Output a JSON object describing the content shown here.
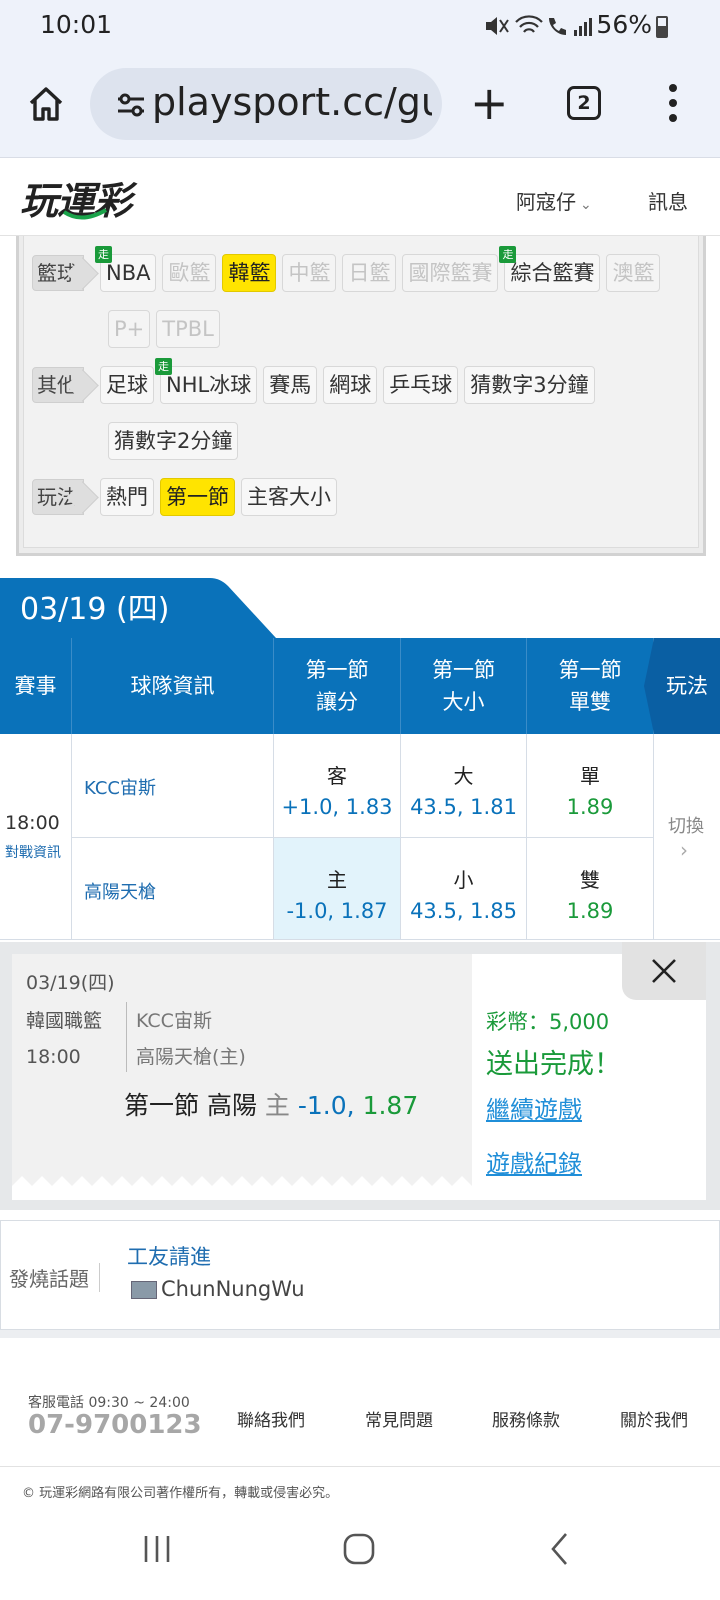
{
  "status_bar": {
    "time": "10:01",
    "battery": "56%"
  },
  "browser": {
    "url": "playsport.cc/gu",
    "tab_count": "2"
  },
  "site": {
    "logo": "玩運彩",
    "user_menu": "阿寇仔",
    "messages": "訊息"
  },
  "categories": {
    "basketball": {
      "label": "籃球",
      "chips": [
        {
          "text": "NBA",
          "state": "normal",
          "live": true
        },
        {
          "text": "歐籃",
          "state": "off"
        },
        {
          "text": "韓籃",
          "state": "selected"
        },
        {
          "text": "中籃",
          "state": "off"
        },
        {
          "text": "日籃",
          "state": "off"
        },
        {
          "text": "國際籃賽",
          "state": "off"
        },
        {
          "text": "綜合籃賽",
          "state": "normal",
          "live": true
        },
        {
          "text": "澳籃",
          "state": "off"
        },
        {
          "text": "P+",
          "state": "off"
        },
        {
          "text": "TPBL",
          "state": "off"
        }
      ]
    },
    "other": {
      "label": "其他",
      "chips": [
        {
          "text": "足球",
          "state": "normal"
        },
        {
          "text": "NHL冰球",
          "state": "normal",
          "live": true
        },
        {
          "text": "賽馬",
          "state": "normal"
        },
        {
          "text": "網球",
          "state": "normal"
        },
        {
          "text": "乒乓球",
          "state": "normal"
        },
        {
          "text": "猜數字3分鐘",
          "state": "normal"
        },
        {
          "text": "猜數字2分鐘",
          "state": "normal"
        }
      ]
    },
    "playstyle": {
      "label": "玩法",
      "chips": [
        {
          "text": "熱門",
          "state": "normal"
        },
        {
          "text": "第一節",
          "state": "selected"
        },
        {
          "text": "主客大小",
          "state": "normal"
        }
      ]
    },
    "live_badge": "走"
  },
  "schedule": {
    "date": "03/19 (四)",
    "headers": {
      "event": "賽事",
      "team_info": "球隊資訊",
      "spread_line1": "第一節",
      "spread_line2": "讓分",
      "total_line1": "第一節",
      "total_line2": "大小",
      "oddeven_line1": "第一節",
      "oddeven_line2": "單雙",
      "play": "玩法"
    },
    "game": {
      "time": "18:00",
      "matchup_link": "對戰資訊",
      "switch": "切換",
      "away": {
        "team": "KCC宙斯",
        "spread_side": "客",
        "spread_odds": "+1.0, 1.83",
        "total_side": "大",
        "total_odds": "43.5, 1.81",
        "oe_side": "單",
        "oe_odds": "1.89"
      },
      "home": {
        "team": "高陽天槍",
        "spread_side": "主",
        "spread_odds": "-1.0, 1.87",
        "total_side": "小",
        "total_odds": "43.5, 1.85",
        "oe_side": "雙",
        "oe_odds": "1.89"
      }
    }
  },
  "bet": {
    "date": "03/19(四)",
    "league": "韓國職籃",
    "time": "18:00",
    "team_away": "KCC宙斯",
    "team_home": "高陽天槍(主)",
    "pick_prefix": "第一節 高陽",
    "pick_side": "主",
    "pick_line": "-1.0,",
    "pick_odds": "1.87",
    "coins": "彩幣：5,000",
    "done": "送出完成！",
    "continue": "繼續遊戲",
    "history": "遊戲紀錄"
  },
  "hot_topic": {
    "label": "發燒話題",
    "title": "工友請進",
    "user": "ChunNungWu"
  },
  "footer": {
    "service_hours": "客服電話 09:30 ~ 24:00",
    "phone": "07-9700123",
    "links": [
      "聯絡我們",
      "常見問題",
      "服務條款",
      "關於我們"
    ],
    "copyright": "© 玩運彩網路有限公司著作權所有，轉載或侵害必究。"
  },
  "colors": {
    "primary_blue": "#0a72ba",
    "highlight_yellow": "#ffe400",
    "success_green": "#1a9a3a",
    "link_blue": "#1f8ed8"
  }
}
